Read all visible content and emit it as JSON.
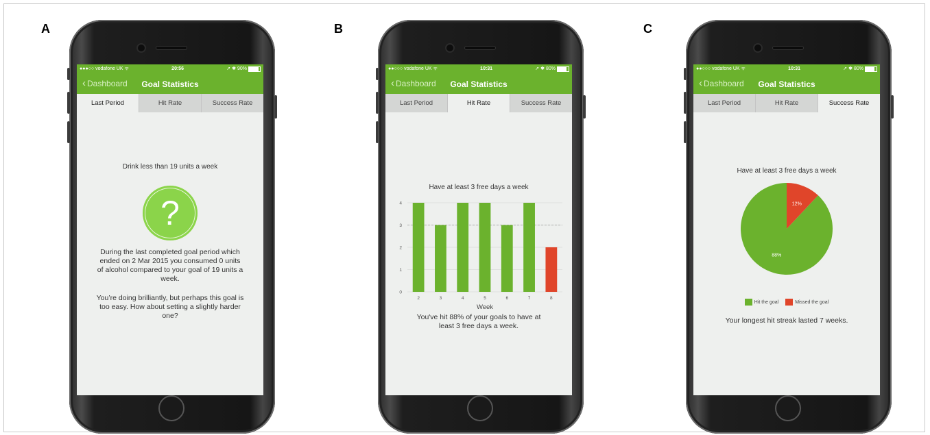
{
  "panels": {
    "a": {
      "label": "A",
      "status": {
        "carrier": "●●●○○ vodafone UK ᯤ",
        "time": "20:56",
        "right": "➚ ✱ 90%",
        "battery_level": 0.9
      },
      "nav": {
        "back_label": "Dashboard",
        "title": "Goal Statistics"
      },
      "tabs": [
        "Last Period",
        "Hit Rate",
        "Success Rate"
      ],
      "active_tab": 0,
      "goal": "Drink less than 19 units a week",
      "icon": "question-mark-icon",
      "icon_glyph": "?",
      "description": "During the last completed goal period which ended on 2 Mar 2015 you consumed 0 units of alcohol compared to your goal of 19 units a week.",
      "advice": "You’re doing brilliantly, but perhaps this goal is too easy. How about setting a slightly harder one?"
    },
    "b": {
      "label": "B",
      "status": {
        "carrier": "●●○○○ vodafone UK ᯤ",
        "time": "10:31",
        "right": "➚ ✱ 80%",
        "battery_level": 0.8
      },
      "nav": {
        "back_label": "Dashboard",
        "title": "Goal Statistics"
      },
      "tabs": [
        "Last Period",
        "Hit Rate",
        "Success Rate"
      ],
      "active_tab": 1,
      "summary": "You've hit 88% of your goals to have at least 3 free days a week."
    },
    "c": {
      "label": "C",
      "status": {
        "carrier": "●●○○○ vodafone UK ᯤ",
        "time": "10:31",
        "right": "➚ ✱ 80%",
        "battery_level": 0.8
      },
      "nav": {
        "back_label": "Dashboard",
        "title": "Goal Statistics"
      },
      "tabs": [
        "Last Period",
        "Hit Rate",
        "Success Rate"
      ],
      "active_tab": 2,
      "summary": "Your longest hit streak lasted 7 weeks."
    }
  },
  "colors": {
    "brand_green": "#6bb22d",
    "bar_green": "#6bb22d",
    "missed_red": "#e0452a",
    "icon_green": "#8bd44a"
  },
  "chart_data": [
    {
      "type": "bar",
      "title": "Have at least 3 free days a week",
      "xlabel": "Week",
      "ylabel": "",
      "categories": [
        "2",
        "3",
        "4",
        "5",
        "6",
        "7",
        "8"
      ],
      "values": [
        4,
        3,
        4,
        4,
        3,
        4,
        2
      ],
      "bar_colors": [
        "#6bb22d",
        "#6bb22d",
        "#6bb22d",
        "#6bb22d",
        "#6bb22d",
        "#6bb22d",
        "#e0452a"
      ],
      "y_ticks": [
        0,
        1,
        2,
        3,
        4
      ],
      "ylim": [
        0,
        4
      ],
      "target_line": 3,
      "grid": true
    },
    {
      "type": "pie",
      "title": "Have at least 3 free days a week",
      "slices": [
        {
          "label": "Hit the goal",
          "value": 88,
          "display": "88%",
          "color": "#6bb22d"
        },
        {
          "label": "Missed the goal",
          "value": 12,
          "display": "12%",
          "color": "#e0452a"
        }
      ],
      "legend_position": "bottom"
    }
  ]
}
